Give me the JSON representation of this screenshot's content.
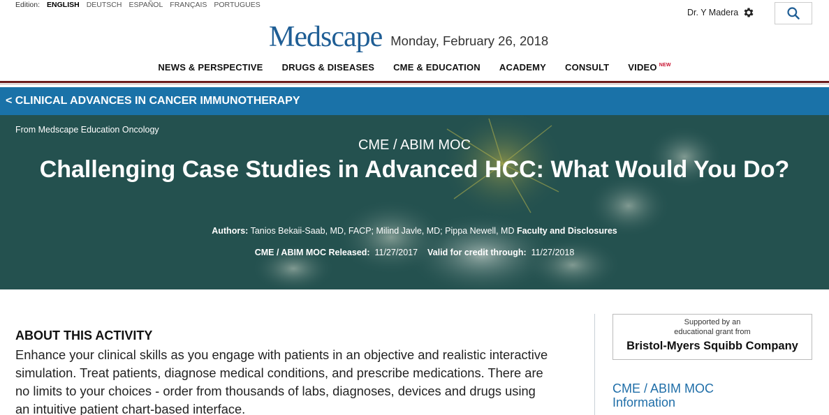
{
  "edition": {
    "label": "Edition:",
    "languages": [
      "ENGLISH",
      "DEUTSCH",
      "ESPAÑOL",
      "FRANÇAIS",
      "PORTUGUES"
    ],
    "active": "ENGLISH"
  },
  "user": {
    "name": "Dr. Y Madera",
    "settings_icon": "gear-icon"
  },
  "search": {
    "icon": "search-icon"
  },
  "brand": {
    "logo_text": "Medscape",
    "date": "Monday, February 26, 2018",
    "logo_color": "#1f5e95"
  },
  "nav": {
    "items": [
      {
        "label": "NEWS & PERSPECTIVE"
      },
      {
        "label": "DRUGS & DISEASES"
      },
      {
        "label": "CME & EDUCATION"
      },
      {
        "label": "ACADEMY"
      },
      {
        "label": "CONSULT"
      },
      {
        "label": "VIDEO",
        "badge": "NEW"
      }
    ]
  },
  "channel": {
    "label": "< CLINICAL ADVANCES IN CANCER IMMUNOTHERAPY",
    "color": "#1a72a8"
  },
  "hero": {
    "source": "From Medscape Education Oncology",
    "type": "CME / ABIM MOC",
    "title": "Challenging Case Studies in Advanced HCC: What Would You Do?",
    "authors_label": "Authors:",
    "authors": "Tanios Bekaii-Saab, MD, FACP; Milind Javle, MD; Pippa Newell, MD",
    "disclosures_label": "Faculty and Disclosures",
    "released_label": "CME / ABIM MOC Released:",
    "released_date": "11/27/2017",
    "valid_label": "Valid for credit through:",
    "valid_date": "11/27/2018"
  },
  "about": {
    "heading": "ABOUT THIS ACTIVITY",
    "text": "Enhance your clinical skills as you engage with patients in an objective and realistic interactive simulation. Treat patients, diagnose medical conditions, and prescribe medications. There are no limits to your choices - order from thousands of labs, diagnoses, devices and drugs using an intuitive patient chart-based interface."
  },
  "sidebar": {
    "support_line1": "Supported by an",
    "support_line2": "educational grant from",
    "sponsor": "Bristol-Myers Squibb Company",
    "cme_info_link": "CME / ABIM MOC Information"
  }
}
